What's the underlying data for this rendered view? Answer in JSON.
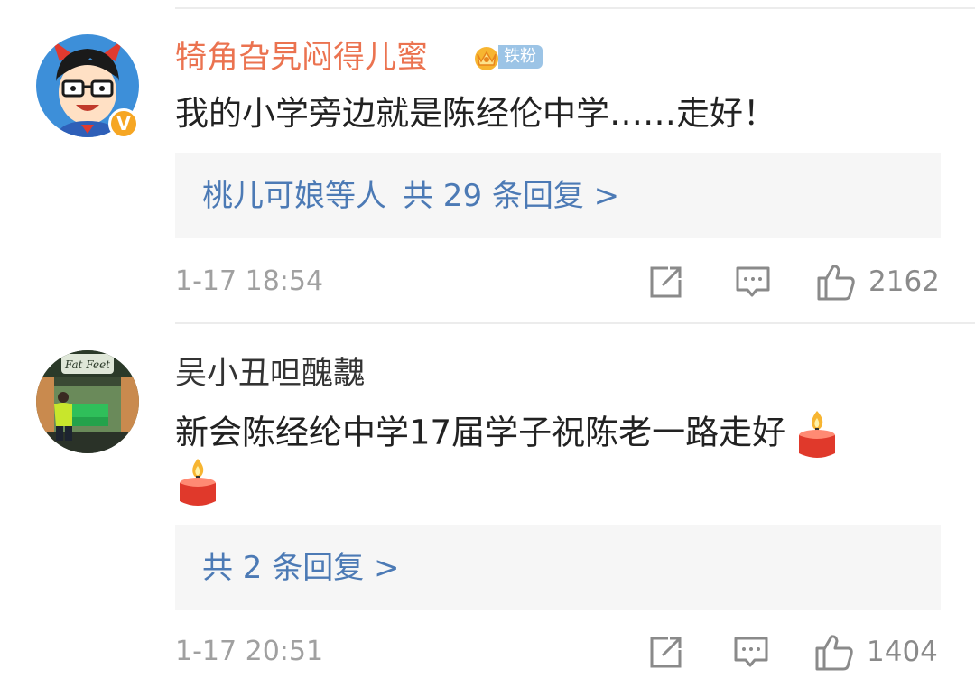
{
  "comments": [
    {
      "username": "犄角旮旯闷得儿蜜",
      "username_color": "#eb7350",
      "fan_badge_label": "铁粉",
      "verified": "V",
      "text": "我的小学旁边就是陈经伦中学……走好！",
      "reply_users": "桃儿可娘等人",
      "reply_count": "共 29 条回复 >",
      "time": "1-17 18:54",
      "likes": "2162",
      "icons": [
        "share-icon",
        "comment-icon",
        "like-icon"
      ]
    },
    {
      "username": "吴小丑呾醜魗",
      "username_color": "#333333",
      "text": "新会陈经纶中学17届学子祝陈老一路走好",
      "reply_count": "共 2 条回复 >",
      "time": "1-17 20:51",
      "likes": "1404",
      "icons": [
        "share-icon",
        "comment-icon",
        "like-icon"
      ],
      "emoji": [
        "candle-emoji",
        "candle-emoji"
      ]
    }
  ],
  "colors": {
    "link_blue": "#4c7ab5",
    "meta_gray": "#a0a0a0",
    "reply_bg": "#f6f6f6",
    "badge_orange": "#f6a623"
  }
}
